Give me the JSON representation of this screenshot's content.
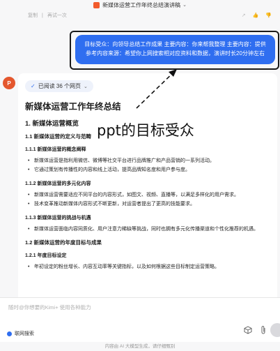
{
  "topbar": {
    "title": "新媒体运营工作年终总结演讲稿",
    "chevron": "⌄"
  },
  "prev_toolbar": {
    "copy_label": "复制",
    "regenerate_label": "再试一次",
    "like_icon": "thumb-up-icon",
    "dislike_icon": "thumb-down-icon",
    "share_icon": "share-icon"
  },
  "user_message": {
    "text": "目标受众：向领导总结工作成果 主要内容：你来帮我整理 主要内容：提供参考内容来源：希望你上网搜索相对应资料和数据，演讲时长20分钟左右"
  },
  "assistant": {
    "avatar_label": "P",
    "read_chip": {
      "check": "✓",
      "label": "已阅读 36 个网页",
      "chevron": "⌄"
    },
    "doc": {
      "title": "新媒体运营工作年终总结",
      "h2_overview": "1. 新媒体运营概览",
      "h3_def": "1.1 新媒体运营的定义与范畴",
      "h4_concept": "1.1.1 新媒体运营的概念阐释",
      "concept_items": [
        "新媒体运营是指利用微信、微博等社交平台进行品牌推广和产品营销的一系列活动。",
        "它通过策划有传播性的内容和线上活动，提高品牌知名度和用户参与度。"
      ],
      "h4_diverse": "1.1.2 新媒体运营的多元化内容",
      "diverse_items": [
        "新媒体运营需要适应不同平台的内容形式，如图文、视频、直播等，以满足多样化的用户需求。",
        "技术变革推动新媒体内容形式不断更新，对运营者提出了更高的技能要求。"
      ],
      "h4_challenge": "1.1.3 新媒体运营的挑战与机遇",
      "challenge_items": [
        "新媒体运营面临内容同质化、用户注意力稀缺等挑战，同时也拥有多元化传播渠道和个性化推荐的机遇。"
      ],
      "h3_goals": "1.2 新媒体运营的年度目标与成果",
      "h4_annual": "1.2.1 年度目标设定",
      "annual_items": [
        "年初设定的粉丝增长、内容互动率等关键指标，以及如何根据这些目标制定运营策略。"
      ]
    }
  },
  "annotation": {
    "text": "ppt的目标受众"
  },
  "input": {
    "placeholder": "随时@你想要的Kimi+ 使用各种能力",
    "web_search_label": "联网搜索",
    "cube_icon": "cube-icon",
    "attach_icon": "paperclip-icon"
  },
  "footer": {
    "note": "内容由 AI 大模型生成，请仔细甄别"
  },
  "colors": {
    "accent": "#2f6ef0",
    "avatar": "#e4572e",
    "outline": "#1a1a1a"
  }
}
